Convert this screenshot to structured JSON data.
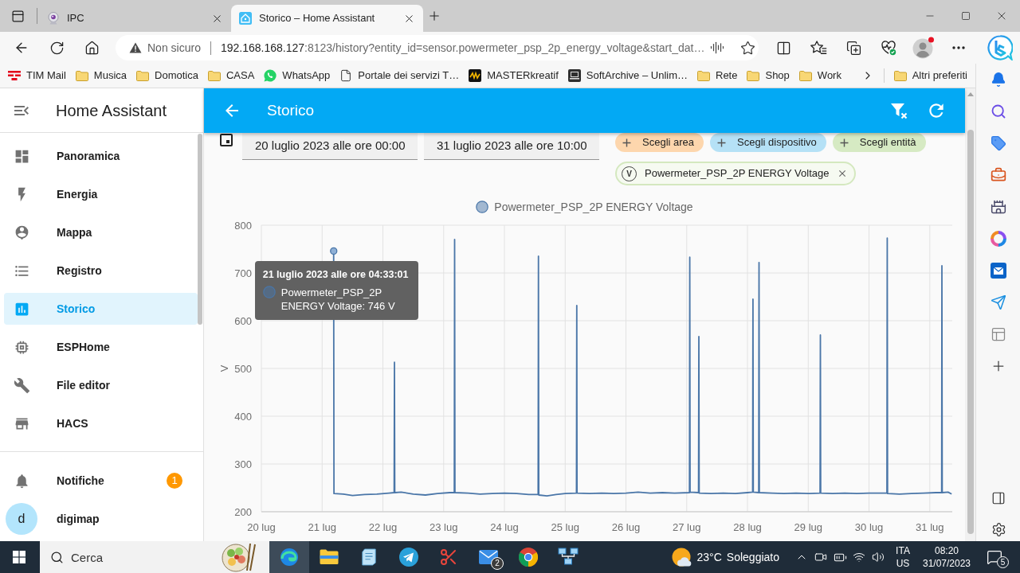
{
  "browser": {
    "tabs": [
      {
        "title": "IPC",
        "selected": false
      },
      {
        "title": "Storico – Home Assistant",
        "selected": true
      }
    ],
    "address": {
      "security": "Non sicuro",
      "host": "192.168.168.127",
      "path": ":8123/history?entity_id=sensor.powermeter_psp_2p_energy_voltage&start_dat…"
    },
    "bookmarks": [
      "TIM Mail",
      "Musica",
      "Domotica",
      "CASA",
      "WhatsApp",
      "Portale dei servizi T…",
      "MASTERkreatif",
      "SoftArchive – Unlim…",
      "Rete",
      "Shop",
      "Work"
    ],
    "other_bookmarks": "Altri preferiti"
  },
  "sidebar": {
    "title": "Home Assistant",
    "items": [
      {
        "label": "Panoramica",
        "selected": false
      },
      {
        "label": "Energia",
        "selected": false
      },
      {
        "label": "Mappa",
        "selected": false
      },
      {
        "label": "Registro",
        "selected": false
      },
      {
        "label": "Storico",
        "selected": true
      },
      {
        "label": "ESPHome",
        "selected": false
      },
      {
        "label": "File editor",
        "selected": false
      },
      {
        "label": "HACS",
        "selected": false
      }
    ],
    "notifications": {
      "label": "Notifiche",
      "count": "1"
    },
    "user": {
      "initial": "d",
      "name": "digimap"
    }
  },
  "app_bar": {
    "title": "Storico"
  },
  "date_range": {
    "start": "20 luglio 2023 alle ore 00:00",
    "end": "31 luglio 2023 alle ore 10:00"
  },
  "pickers": [
    {
      "label": "Scegli area",
      "color": "#fdd6ad"
    },
    {
      "label": "Scegli dispositivo",
      "color": "#b5e1f6"
    },
    {
      "label": "Scegli entità",
      "color": "#d6eac3"
    }
  ],
  "selected_entities": [
    {
      "unit": "V",
      "label": "Powermeter_PSP_2P ENERGY Voltage"
    }
  ],
  "chart": {
    "chart_data": {
      "type": "line",
      "ylabel": "V",
      "grid": true,
      "x": [
        21.19,
        21.195,
        21.35,
        21.5,
        21.7,
        21.9,
        22.1,
        22.185,
        22.19,
        22.195,
        22.3,
        22.5,
        22.7,
        22.9,
        23.1,
        23.175,
        23.18,
        23.185,
        23.4,
        23.6,
        23.8,
        24.0,
        24.2,
        24.4,
        24.555,
        24.56,
        24.565,
        24.7,
        24.85,
        25.0,
        25.185,
        25.19,
        25.195,
        25.4,
        25.6,
        25.8,
        26.0,
        26.2,
        26.4,
        26.6,
        26.8,
        27.045,
        27.05,
        27.055,
        27.195,
        27.2,
        27.205,
        27.4,
        27.6,
        27.8,
        28.0,
        28.085,
        28.09,
        28.095,
        28.185,
        28.19,
        28.195,
        28.4,
        28.6,
        28.8,
        29.0,
        29.195,
        29.2,
        29.205,
        29.4,
        29.6,
        29.8,
        30.0,
        30.2,
        30.295,
        30.3,
        30.305,
        30.5,
        30.7,
        30.9,
        31.1,
        31.195,
        31.2,
        31.205,
        31.3,
        31.36
      ],
      "series": [
        {
          "name": "Powermeter_PSP_2P ENERGY Voltage",
          "color": "#4a76a8",
          "values": [
            746,
            238,
            237,
            234,
            236,
            237,
            239,
            240,
            513,
            240,
            241,
            237,
            235,
            238,
            240,
            240,
            770,
            240,
            239,
            237,
            238,
            239,
            238,
            236,
            236,
            735,
            235,
            233,
            236,
            238,
            239,
            632,
            239,
            238,
            239,
            238,
            239,
            241,
            239,
            240,
            239,
            240,
            733,
            241,
            240,
            567,
            239,
            238,
            239,
            238,
            240,
            241,
            645,
            241,
            240,
            722,
            240,
            239,
            238,
            239,
            238,
            239,
            570,
            239,
            238,
            239,
            238,
            239,
            239,
            239,
            773,
            238,
            237,
            238,
            239,
            240,
            240,
            715,
            240,
            241,
            237
          ]
        }
      ],
      "xlim": [
        20,
        31.37
      ],
      "ylim": [
        200,
        800
      ],
      "yticks": [
        200,
        300,
        400,
        500,
        600,
        700,
        800
      ],
      "xticks": [
        {
          "value": 20,
          "label": "20 lug"
        },
        {
          "value": 21,
          "label": "21 lug"
        },
        {
          "value": 22,
          "label": "22 lug"
        },
        {
          "value": 23,
          "label": "23 lug"
        },
        {
          "value": 24,
          "label": "24 lug"
        },
        {
          "value": 25,
          "label": "25 lug"
        },
        {
          "value": 26,
          "label": "26 lug"
        },
        {
          "value": 27,
          "label": "27 lug"
        },
        {
          "value": 28,
          "label": "28 lug"
        },
        {
          "value": 29,
          "label": "29 lug"
        },
        {
          "value": 30,
          "label": "30 lug"
        },
        {
          "value": 31,
          "label": "31 lug"
        }
      ]
    },
    "tooltip": {
      "title": "21 luglio 2023 alle ore 04:33:01",
      "text": "Powermeter_PSP_2P ENERGY Voltage: 746 V"
    }
  },
  "taskbar": {
    "search": {
      "placeholder": "Cerca"
    },
    "apps": [
      {
        "selected": true
      },
      {
        "selected": false
      },
      {
        "selected": false
      },
      {
        "selected": false
      },
      {
        "selected": false
      },
      {
        "selected": false,
        "count": "2"
      },
      {
        "selected": false
      },
      {
        "selected": false
      }
    ],
    "weather": {
      "temperature": "23°C",
      "condition": "Soleggiato"
    },
    "language": {
      "input": "ITA",
      "layout": "US"
    },
    "time": "08:20",
    "date": "31/07/2023",
    "notification_count": "5"
  }
}
